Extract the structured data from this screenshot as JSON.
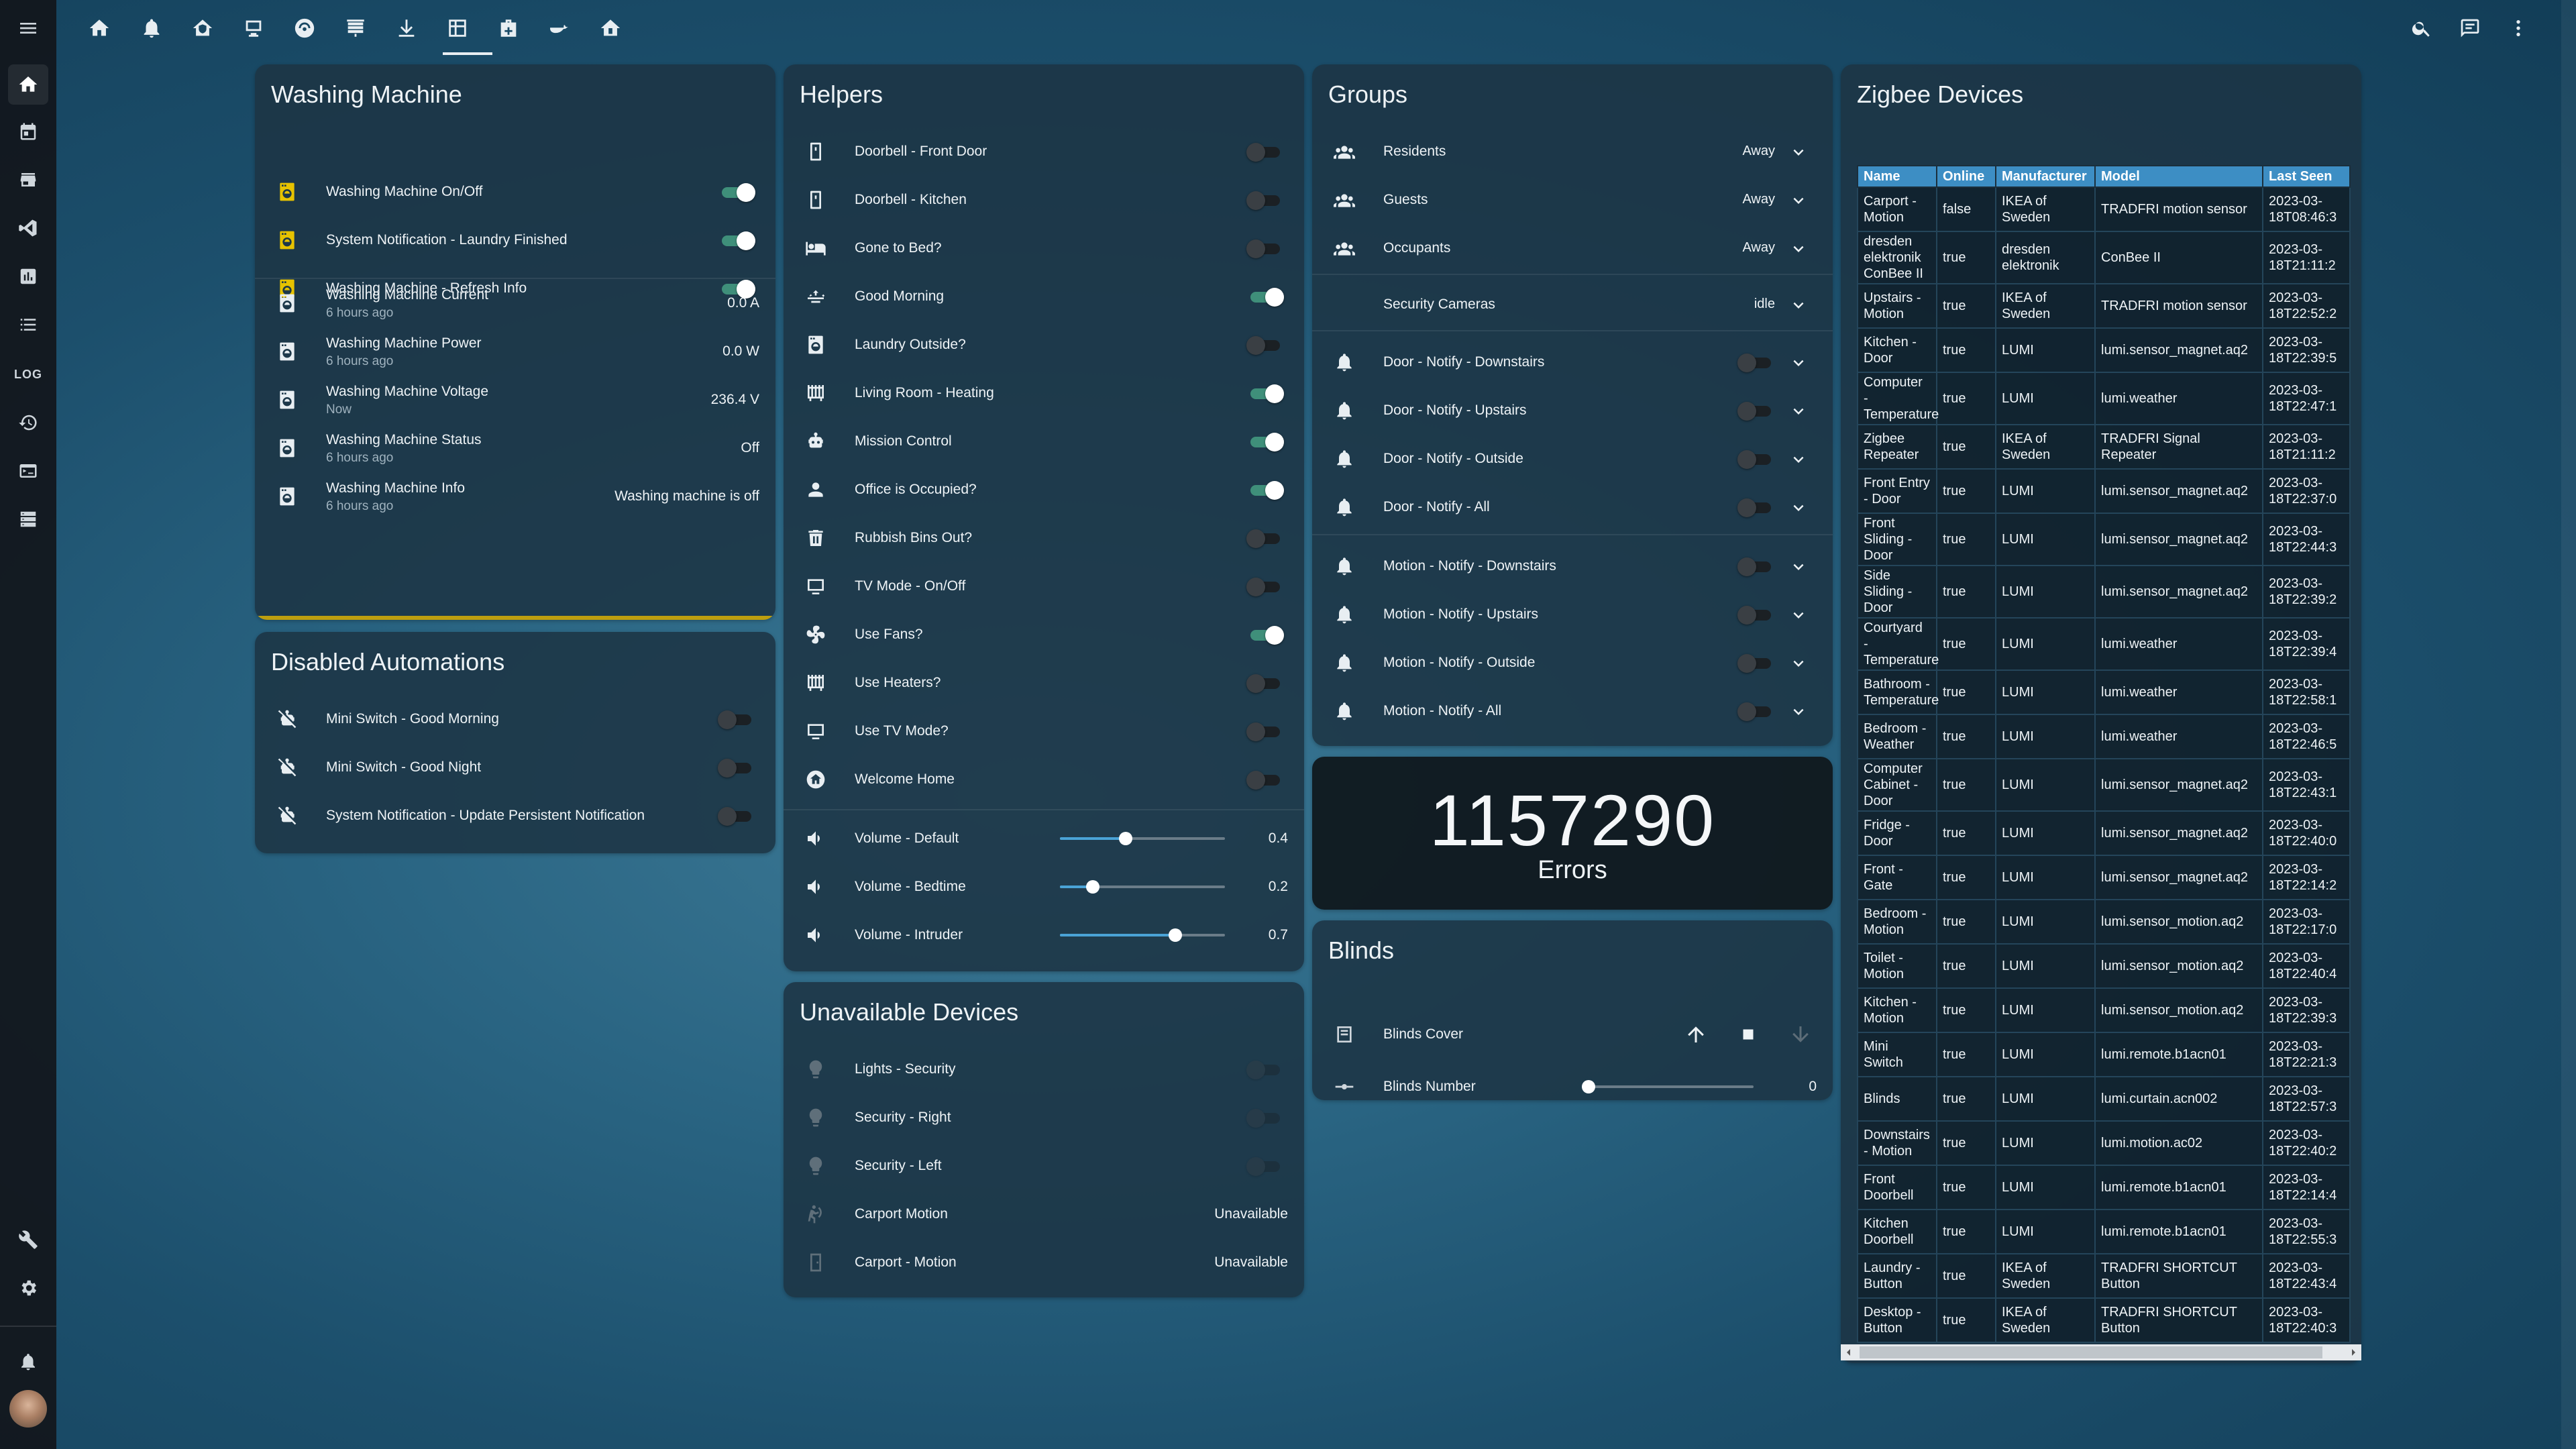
{
  "topbar": {
    "icons": [
      "home-icon",
      "bell-icon",
      "house-shield-icon",
      "desk-icon",
      "robot-vacuum-icon",
      "blinds-icon",
      "arrow-down-bar-icon",
      "calendar-grid-icon",
      "medical-bag-icon",
      "whale-icon",
      "home-security-icon"
    ],
    "right_icons": [
      "search-icon",
      "chat-icon",
      "dots-vertical-icon"
    ]
  },
  "washing": {
    "title": "Washing Machine",
    "toggles": [
      {
        "label": "Washing Machine On/Off",
        "on": true
      },
      {
        "label": "System Notification - Laundry Finished",
        "on": true
      },
      {
        "label": "Washing Machine - Refresh Info",
        "on": true
      }
    ],
    "sensors": [
      {
        "label": "Washing Machine Current",
        "sub": "6 hours ago",
        "value": "0.0 A"
      },
      {
        "label": "Washing Machine Power",
        "sub": "6 hours ago",
        "value": "0.0 W"
      },
      {
        "label": "Washing Machine Voltage",
        "sub": "Now",
        "value": "236.4 V"
      },
      {
        "label": "Washing Machine Status",
        "sub": "6 hours ago",
        "value": "Off"
      },
      {
        "label": "Washing Machine Info",
        "sub": "6 hours ago",
        "value": "Washing machine is off"
      }
    ]
  },
  "disabled": {
    "title": "Disabled Automations",
    "rows": [
      {
        "label": "Mini Switch - Good Morning"
      },
      {
        "label": "Mini Switch - Good Night"
      },
      {
        "label": "System Notification - Update Persistent Notification"
      }
    ]
  },
  "helpers": {
    "title": "Helpers",
    "toggles": [
      {
        "label": "Doorbell - Front Door",
        "on": false,
        "icon": "doorbell-icon"
      },
      {
        "label": "Doorbell - Kitchen",
        "on": false,
        "icon": "doorbell-icon"
      },
      {
        "label": "Gone to Bed?",
        "on": false,
        "icon": "bed-icon"
      },
      {
        "label": "Good Morning",
        "on": true,
        "icon": "sunrise-icon"
      },
      {
        "label": "Laundry Outside?",
        "on": false,
        "icon": "washing-machine-icon"
      },
      {
        "label": "Living Room - Heating",
        "on": true,
        "icon": "radiator-icon"
      },
      {
        "label": "Mission Control",
        "on": true,
        "icon": "robot-icon"
      },
      {
        "label": "Office is Occupied?",
        "on": true,
        "icon": "account-icon"
      },
      {
        "label": "Rubbish Bins Out?",
        "on": false,
        "icon": "trash-icon"
      },
      {
        "label": "TV Mode - On/Off",
        "on": false,
        "icon": "monitor-icon"
      },
      {
        "label": "Use Fans?",
        "on": true,
        "icon": "fan-icon"
      },
      {
        "label": "Use Heaters?",
        "on": false,
        "icon": "radiator-icon"
      },
      {
        "label": "Use TV Mode?",
        "on": false,
        "icon": "monitor-icon"
      },
      {
        "label": "Welcome Home",
        "on": false,
        "icon": "home-circle-icon"
      }
    ],
    "sliders": [
      {
        "label": "Volume - Default",
        "value": "0.4",
        "fraction": 0.4
      },
      {
        "label": "Volume - Bedtime",
        "value": "0.2",
        "fraction": 0.2
      },
      {
        "label": "Volume - Intruder",
        "value": "0.7",
        "fraction": 0.7
      }
    ]
  },
  "unavailable": {
    "title": "Unavailable Devices",
    "rows": [
      {
        "label": "Lights - Security",
        "type": "toggle"
      },
      {
        "label": "Security - Right",
        "type": "toggle"
      },
      {
        "label": "Security - Left",
        "type": "toggle"
      },
      {
        "label": "Carport Motion",
        "type": "text",
        "value": "Unavailable"
      },
      {
        "label": "Carport - Motion",
        "type": "text",
        "value": "Unavailable"
      }
    ]
  },
  "groups": {
    "title": "Groups",
    "people": [
      {
        "label": "Residents",
        "value": "Away"
      },
      {
        "label": "Guests",
        "value": "Away"
      },
      {
        "label": "Occupants",
        "value": "Away"
      }
    ],
    "cameras": {
      "label": "Security Cameras",
      "value": "idle"
    },
    "door_notify": [
      {
        "label": "Door - Notify - Downstairs"
      },
      {
        "label": "Door - Notify - Upstairs"
      },
      {
        "label": "Door - Notify - Outside"
      },
      {
        "label": "Door - Notify - All"
      }
    ],
    "motion_notify": [
      {
        "label": "Motion - Notify - Downstairs"
      },
      {
        "label": "Motion - Notify - Upstairs"
      },
      {
        "label": "Motion - Notify - Outside"
      },
      {
        "label": "Motion - Notify - All"
      }
    ]
  },
  "errors": {
    "number": "1157290",
    "label": "Errors"
  },
  "blinds": {
    "title": "Blinds",
    "cover_label": "Blinds Cover",
    "number_label": "Blinds Number",
    "number_value": "0",
    "number_fraction": 0
  },
  "zigbee": {
    "title": "Zigbee Devices",
    "columns": [
      "Name",
      "Online",
      "Manufacturer",
      "Model",
      "Last Seen"
    ],
    "rows": [
      [
        "Carport - Motion",
        "false",
        "IKEA of Sweden",
        "TRADFRI motion sensor",
        "2023-03-18T08:46:3"
      ],
      [
        "dresden elektronik ConBee II",
        "true",
        "dresden elektronik",
        "ConBee II",
        "2023-03-18T21:11:2"
      ],
      [
        "Upstairs - Motion",
        "true",
        "IKEA of Sweden",
        "TRADFRI motion sensor",
        "2023-03-18T22:52:2"
      ],
      [
        "Kitchen - Door",
        "true",
        "LUMI",
        "lumi.sensor_magnet.aq2",
        "2023-03-18T22:39:5"
      ],
      [
        "Computer - Temperature",
        "true",
        "LUMI",
        "lumi.weather",
        "2023-03-18T22:47:1"
      ],
      [
        "Zigbee Repeater",
        "true",
        "IKEA of Sweden",
        "TRADFRI Signal Repeater",
        "2023-03-18T21:11:2"
      ],
      [
        "Front Entry - Door",
        "true",
        "LUMI",
        "lumi.sensor_magnet.aq2",
        "2023-03-18T22:37:0"
      ],
      [
        "Front Sliding - Door",
        "true",
        "LUMI",
        "lumi.sensor_magnet.aq2",
        "2023-03-18T22:44:3"
      ],
      [
        "Side Sliding - Door",
        "true",
        "LUMI",
        "lumi.sensor_magnet.aq2",
        "2023-03-18T22:39:2"
      ],
      [
        "Courtyard - Temperature",
        "true",
        "LUMI",
        "lumi.weather",
        "2023-03-18T22:39:4"
      ],
      [
        "Bathroom - Temperature",
        "true",
        "LUMI",
        "lumi.weather",
        "2023-03-18T22:58:1"
      ],
      [
        "Bedroom - Weather",
        "true",
        "LUMI",
        "lumi.weather",
        "2023-03-18T22:46:5"
      ],
      [
        "Computer Cabinet - Door",
        "true",
        "LUMI",
        "lumi.sensor_magnet.aq2",
        "2023-03-18T22:43:1"
      ],
      [
        "Fridge - Door",
        "true",
        "LUMI",
        "lumi.sensor_magnet.aq2",
        "2023-03-18T22:40:0"
      ],
      [
        "Front - Gate",
        "true",
        "LUMI",
        "lumi.sensor_magnet.aq2",
        "2023-03-18T22:14:2"
      ],
      [
        "Bedroom - Motion",
        "true",
        "LUMI",
        "lumi.sensor_motion.aq2",
        "2023-03-18T22:17:0"
      ],
      [
        "Toilet - Motion",
        "true",
        "LUMI",
        "lumi.sensor_motion.aq2",
        "2023-03-18T22:40:4"
      ],
      [
        "Kitchen - Motion",
        "true",
        "LUMI",
        "lumi.sensor_motion.aq2",
        "2023-03-18T22:39:3"
      ],
      [
        "Mini Switch",
        "true",
        "LUMI",
        "lumi.remote.b1acn01",
        "2023-03-18T22:21:3"
      ],
      [
        "Blinds",
        "true",
        "LUMI",
        "lumi.curtain.acn002",
        "2023-03-18T22:57:3"
      ],
      [
        "Downstairs - Motion",
        "true",
        "LUMI",
        "lumi.motion.ac02",
        "2023-03-18T22:40:2"
      ],
      [
        "Front Doorbell",
        "true",
        "LUMI",
        "lumi.remote.b1acn01",
        "2023-03-18T22:14:4"
      ],
      [
        "Kitchen Doorbell",
        "true",
        "LUMI",
        "lumi.remote.b1acn01",
        "2023-03-18T22:55:3"
      ],
      [
        "Laundry - Button",
        "true",
        "IKEA of Sweden",
        "TRADFRI SHORTCUT Button",
        "2023-03-18T22:43:4"
      ],
      [
        "Desktop - Button",
        "true",
        "IKEA of Sweden",
        "TRADFRI SHORTCUT Button",
        "2023-03-18T22:40:3"
      ]
    ]
  },
  "sidebar": {
    "log_label": "LOG"
  },
  "colors": {
    "accent": "#3f8f7a",
    "table_header": "#3d8ec4",
    "slider": "#4aa3d6",
    "washing_icon": "#e6c200"
  }
}
